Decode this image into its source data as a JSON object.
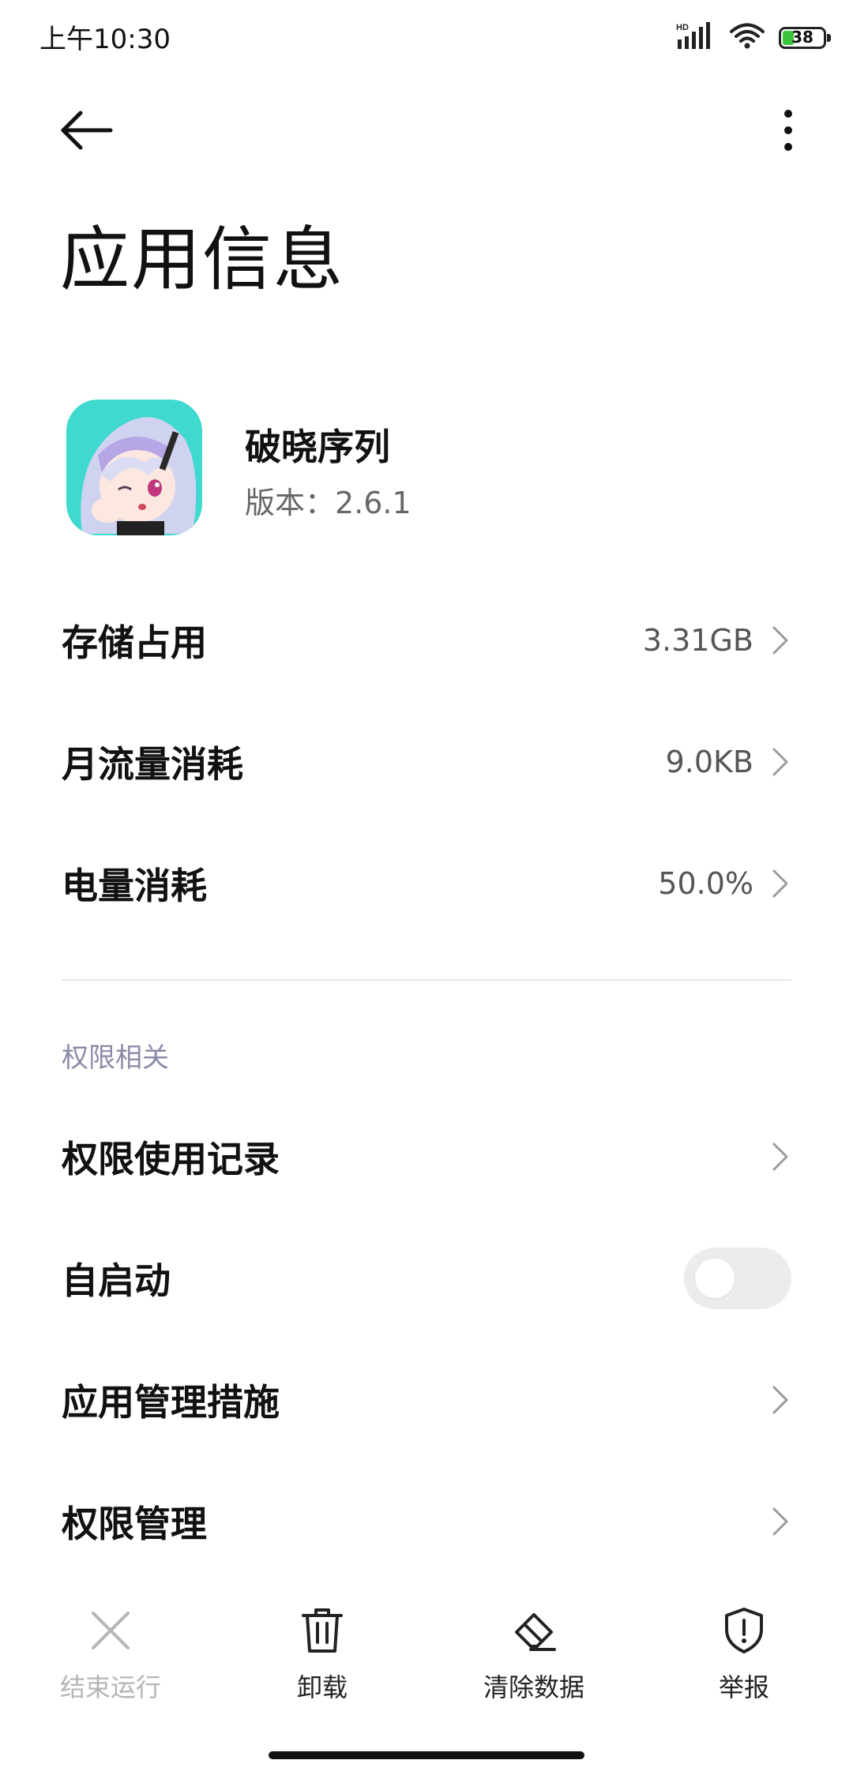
{
  "status_bar": {
    "time": "上午10:30",
    "battery_level": "38",
    "icons": [
      "hd-signal-icon",
      "wifi-icon",
      "battery-icon"
    ]
  },
  "header": {
    "back_icon": "back-arrow-icon",
    "more_icon": "more-vertical-icon",
    "title": "应用信息"
  },
  "app": {
    "name": "破晓序列",
    "version": "版本：2.6.1",
    "icon_bg_color": "#3fd9cf"
  },
  "usage": [
    {
      "label": "存储占用",
      "value": "3.31GB"
    },
    {
      "label": "月流量消耗",
      "value": "9.0KB"
    },
    {
      "label": "电量消耗",
      "value": "50.0%"
    }
  ],
  "permissions": {
    "section_label": "权限相关",
    "items": [
      {
        "label": "权限使用记录",
        "type": "link"
      },
      {
        "label": "自启动",
        "type": "toggle",
        "enabled": false
      },
      {
        "label": "应用管理措施",
        "type": "link"
      },
      {
        "label": "权限管理",
        "type": "link"
      }
    ]
  },
  "bottom_actions": [
    {
      "label": "结束运行",
      "icon": "close-icon",
      "enabled": false
    },
    {
      "label": "卸载",
      "icon": "trash-icon",
      "enabled": true
    },
    {
      "label": "清除数据",
      "icon": "eraser-icon",
      "enabled": true
    },
    {
      "label": "举报",
      "icon": "shield-alert-icon",
      "enabled": true
    }
  ],
  "colors": {
    "section_label": "#8b8ba8",
    "battery_fill": "#3bc53b",
    "toggle_off": "#ececec",
    "disabled_text": "#b5b5b5"
  }
}
